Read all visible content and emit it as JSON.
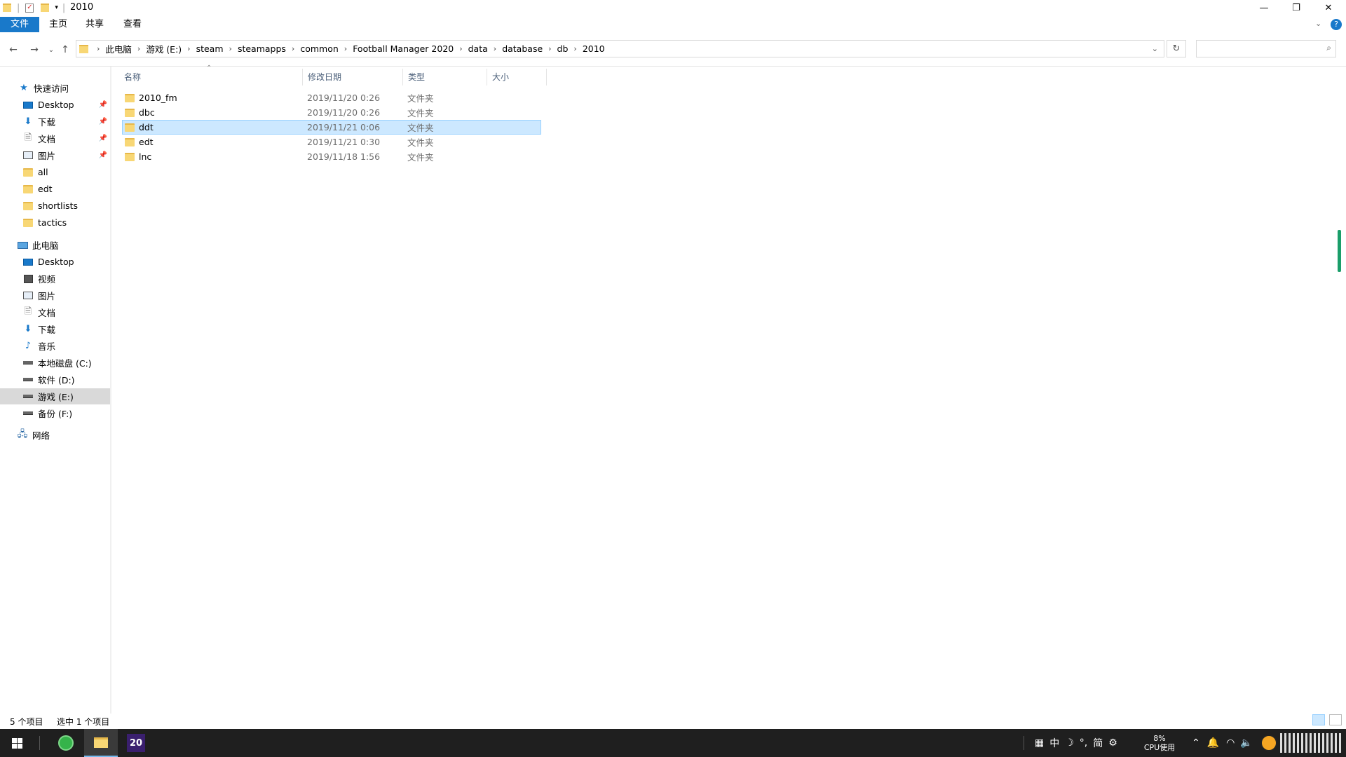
{
  "window": {
    "title": "2010",
    "minimize": "—",
    "restore": "❐",
    "close": "✕"
  },
  "ribbon": {
    "tabs": [
      {
        "label": "文件"
      },
      {
        "label": "主页"
      },
      {
        "label": "共享"
      },
      {
        "label": "查看"
      }
    ]
  },
  "address": {
    "breadcrumb": [
      "此电脑",
      "游戏 (E:)",
      "steam",
      "steamapps",
      "common",
      "Football Manager 2020",
      "data",
      "database",
      "db",
      "2010"
    ],
    "search_placeholder": ""
  },
  "navpane": {
    "quick_access_label": "快速访问",
    "quick_items": [
      {
        "label": "Desktop",
        "icon": "desktop-icon"
      },
      {
        "label": "下载",
        "icon": "download-icon"
      },
      {
        "label": "文档",
        "icon": "document-icon"
      },
      {
        "label": "图片",
        "icon": "pictures-icon"
      },
      {
        "label": "all",
        "icon": "folder-icon"
      },
      {
        "label": "edt",
        "icon": "folder-icon"
      },
      {
        "label": "shortlists",
        "icon": "folder-icon"
      },
      {
        "label": "tactics",
        "icon": "folder-icon"
      }
    ],
    "this_pc_label": "此电脑",
    "pc_items": [
      {
        "label": "Desktop",
        "icon": "desktop-icon"
      },
      {
        "label": "视频",
        "icon": "video-icon"
      },
      {
        "label": "图片",
        "icon": "pictures-icon"
      },
      {
        "label": "文档",
        "icon": "document-icon"
      },
      {
        "label": "下载",
        "icon": "download-icon"
      },
      {
        "label": "音乐",
        "icon": "music-icon"
      },
      {
        "label": "本地磁盘 (C:)",
        "icon": "drive-icon"
      },
      {
        "label": "软件 (D:)",
        "icon": "drive-icon"
      },
      {
        "label": "游戏 (E:)",
        "icon": "drive-icon"
      },
      {
        "label": "备份 (F:)",
        "icon": "drive-icon"
      }
    ],
    "network_label": "网络"
  },
  "columns": {
    "name": "名称",
    "modified": "修改日期",
    "type": "类型",
    "size": "大小"
  },
  "files": [
    {
      "name": "2010_fm",
      "modified": "2019/11/20 0:26",
      "type": "文件夹"
    },
    {
      "name": "dbc",
      "modified": "2019/11/20 0:26",
      "type": "文件夹"
    },
    {
      "name": "ddt",
      "modified": "2019/11/21 0:06",
      "type": "文件夹"
    },
    {
      "name": "edt",
      "modified": "2019/11/21 0:30",
      "type": "文件夹"
    },
    {
      "name": "lnc",
      "modified": "2019/11/18 1:56",
      "type": "文件夹"
    }
  ],
  "status": {
    "count": "5 个项目",
    "selected": "选中 1 个项目"
  },
  "taskbar": {
    "app_badge": "20",
    "ime": [
      "中",
      "简"
    ],
    "cpu_percent": "8%",
    "cpu_label": "CPU使用"
  },
  "colors": {
    "accent": "#1979ca",
    "selection": "#cce8ff",
    "folder": "#f8d775"
  }
}
